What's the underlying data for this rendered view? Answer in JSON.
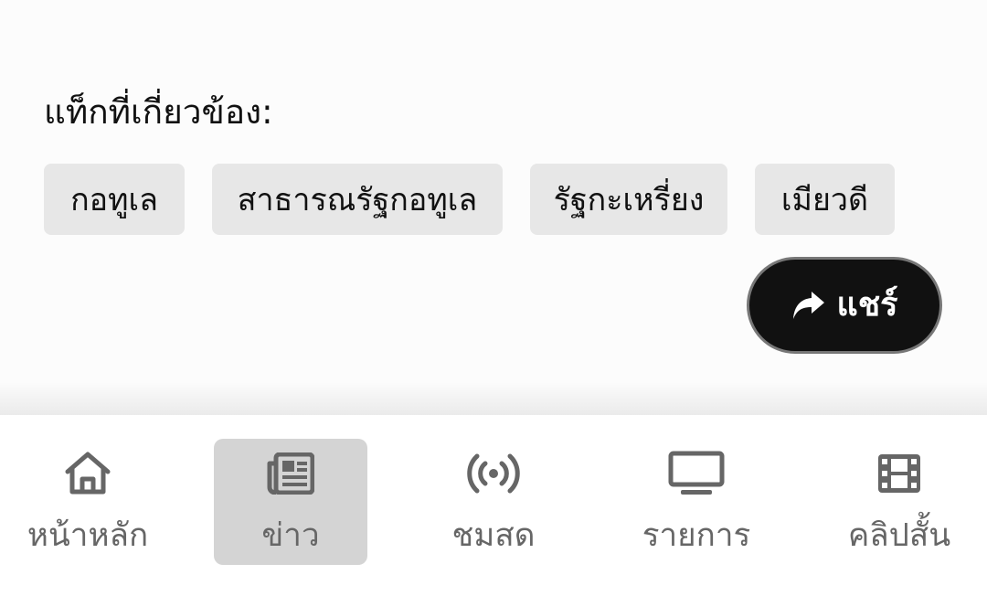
{
  "tags_section": {
    "heading": "แท็กที่เกี่ยวข้อง:",
    "tags": [
      "กอทูเล",
      "สาธารณรัฐกอทูเล",
      "รัฐกะเหรี่ยง",
      "เมียวดี"
    ]
  },
  "share_button": {
    "label": "แชร์",
    "icon": "share-arrow-icon"
  },
  "bottom_nav": {
    "active_index": 1,
    "items": [
      {
        "label": "หน้าหลัก",
        "icon": "home-icon"
      },
      {
        "label": "ข่าว",
        "icon": "newspaper-icon"
      },
      {
        "label": "ชมสด",
        "icon": "broadcast-icon"
      },
      {
        "label": "รายการ",
        "icon": "tv-icon"
      },
      {
        "label": "คลิปสั้น",
        "icon": "film-icon"
      }
    ]
  },
  "colors": {
    "page_background": "#fcfcfc",
    "tag_background": "#e7e7e7",
    "share_button_background": "#111111",
    "nav_active_background": "#d4d4d4",
    "nav_icon": "#666666"
  }
}
